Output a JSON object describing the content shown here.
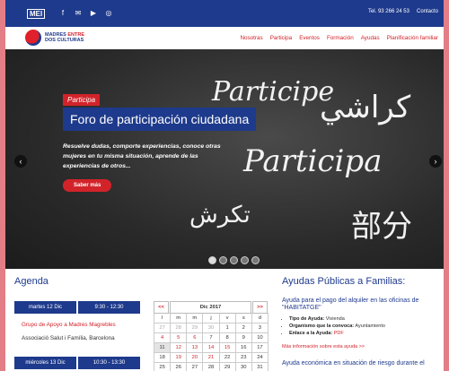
{
  "topbar": {
    "logo": "MEI",
    "social": [
      "f",
      "✉",
      "▶",
      "◎"
    ],
    "phone": "Tel. 93 266 24 53",
    "contact": "Contacto"
  },
  "header": {
    "brand_line1_a": "MADRES",
    "brand_line1_b": "ENTRE",
    "brand_line2": "DOS CULTURAS",
    "nav": [
      "Nosotras",
      "Participa",
      "Eventos",
      "Formación",
      "Ayudas",
      "Planificación familiar"
    ]
  },
  "hero": {
    "chalk": [
      "Participe",
      "كراشي",
      "Participa",
      "تكرش",
      "部分"
    ],
    "tag": "Participa",
    "title": "Foro de participación ciudadana",
    "text": "Resuelve dudas, comporte experiencias, conoce otras mujeres en tu misma situación, aprende de las experiencias de otros...",
    "button": "Saber más",
    "prev": "‹",
    "next": "›",
    "active_slide": 1,
    "slide_count": 5
  },
  "agenda": {
    "title": "Agenda",
    "events": [
      {
        "date": "martes 12 Dic",
        "time": "9:30 - 12:30",
        "title": "Grupo de Apoyo a Madres Magrebles",
        "place": "Associació Salut i Família, Barcelona"
      },
      {
        "date": "miércoles 13 Dic",
        "time": "10:30 - 13:30",
        "title": "",
        "place": ""
      }
    ],
    "calendar": {
      "prev": "<<",
      "month": "Dic 2017",
      "next": ">>",
      "weekdays": [
        "l",
        "m",
        "m",
        "j",
        "v",
        "s",
        "d"
      ],
      "weeks": [
        [
          "27",
          "28",
          "29",
          "30",
          "1",
          "2",
          "3"
        ],
        [
          "4",
          "5",
          "6",
          "7",
          "8",
          "9",
          "10"
        ],
        [
          "11",
          "12",
          "13",
          "14",
          "15",
          "16",
          "17"
        ],
        [
          "18",
          "19",
          "20",
          "21",
          "22",
          "23",
          "24"
        ],
        [
          "25",
          "26",
          "27",
          "28",
          "29",
          "30",
          "31"
        ]
      ]
    }
  },
  "ayudas": {
    "title": "Ayudas Públicas a Familias:",
    "item_title": "Ayuda para el pago del alquiler en las oficinas de \"HABITATGE\"",
    "list": [
      {
        "label": "Tipo de Ayuda:",
        "value": "Vivienda"
      },
      {
        "label": "Organismo que la convoca:",
        "value": "Ayuntamiento"
      },
      {
        "label": "Enlace a la Ayuda:",
        "value": "PDF"
      }
    ],
    "more": "Más información sobre esta ayuda >>",
    "next_title": "Ayuda económica en situación de riesgo durante el"
  },
  "colors": {
    "brand_blue": "#1e3a8c",
    "brand_red": "#d2232a",
    "page_bg": "#e37e86"
  }
}
